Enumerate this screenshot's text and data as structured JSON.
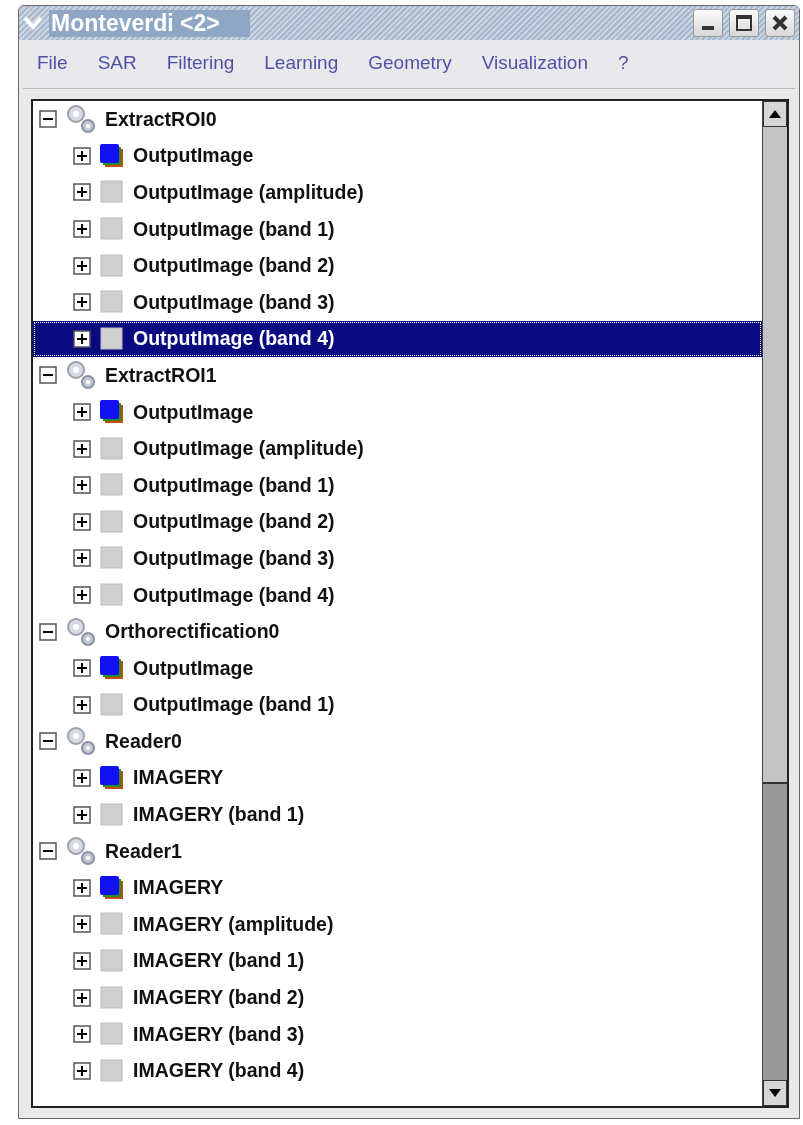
{
  "window": {
    "title": "Monteverdi <2>"
  },
  "menu": [
    "File",
    "SAR",
    "Filtering",
    "Learning",
    "Geometry",
    "Visualization",
    "?"
  ],
  "tree": [
    {
      "label": "ExtractROI0",
      "kind": "filter",
      "expanded": true,
      "selected": false,
      "children": [
        {
          "label": "OutputImage",
          "kind": "multiband",
          "expanded": false,
          "selected": false
        },
        {
          "label": "OutputImage (amplitude)",
          "kind": "band",
          "expanded": false,
          "selected": false
        },
        {
          "label": "OutputImage (band 1)",
          "kind": "band",
          "expanded": false,
          "selected": false
        },
        {
          "label": "OutputImage (band 2)",
          "kind": "band",
          "expanded": false,
          "selected": false
        },
        {
          "label": "OutputImage (band 3)",
          "kind": "band",
          "expanded": false,
          "selected": false
        },
        {
          "label": "OutputImage (band 4)",
          "kind": "band",
          "expanded": false,
          "selected": true
        }
      ]
    },
    {
      "label": "ExtractROI1",
      "kind": "filter",
      "expanded": true,
      "selected": false,
      "children": [
        {
          "label": "OutputImage",
          "kind": "multiband",
          "expanded": false,
          "selected": false
        },
        {
          "label": "OutputImage (amplitude)",
          "kind": "band",
          "expanded": false,
          "selected": false
        },
        {
          "label": "OutputImage (band 1)",
          "kind": "band",
          "expanded": false,
          "selected": false
        },
        {
          "label": "OutputImage (band 2)",
          "kind": "band",
          "expanded": false,
          "selected": false
        },
        {
          "label": "OutputImage (band 3)",
          "kind": "band",
          "expanded": false,
          "selected": false
        },
        {
          "label": "OutputImage (band 4)",
          "kind": "band",
          "expanded": false,
          "selected": false
        }
      ]
    },
    {
      "label": "Orthorectification0",
      "kind": "filter",
      "expanded": true,
      "selected": false,
      "children": [
        {
          "label": "OutputImage",
          "kind": "multiband",
          "expanded": false,
          "selected": false
        },
        {
          "label": "OutputImage (band 1)",
          "kind": "band",
          "expanded": false,
          "selected": false
        }
      ]
    },
    {
      "label": "Reader0",
      "kind": "filter",
      "expanded": true,
      "selected": false,
      "children": [
        {
          "label": "IMAGERY",
          "kind": "multiband",
          "expanded": false,
          "selected": false
        },
        {
          "label": "IMAGERY (band 1)",
          "kind": "band",
          "expanded": false,
          "selected": false
        }
      ]
    },
    {
      "label": "Reader1",
      "kind": "filter",
      "expanded": true,
      "selected": false,
      "children": [
        {
          "label": "IMAGERY",
          "kind": "multiband",
          "expanded": false,
          "selected": false
        },
        {
          "label": "IMAGERY (amplitude)",
          "kind": "band",
          "expanded": false,
          "selected": false
        },
        {
          "label": "IMAGERY (band 1)",
          "kind": "band",
          "expanded": false,
          "selected": false
        },
        {
          "label": "IMAGERY (band 2)",
          "kind": "band",
          "expanded": false,
          "selected": false
        },
        {
          "label": "IMAGERY (band 3)",
          "kind": "band",
          "expanded": false,
          "selected": false
        },
        {
          "label": "IMAGERY (band 4)",
          "kind": "band",
          "expanded": false,
          "selected": false
        }
      ]
    }
  ]
}
